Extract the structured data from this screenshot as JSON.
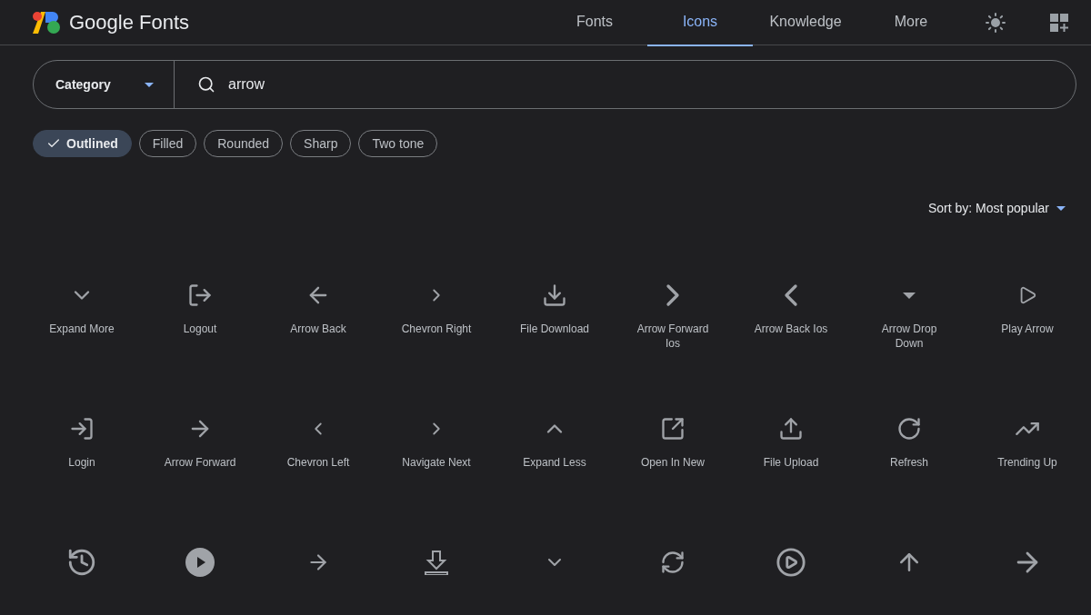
{
  "header": {
    "brand": "Google Fonts",
    "nav": [
      {
        "label": "Fonts",
        "selected": false
      },
      {
        "label": "Icons",
        "selected": true
      },
      {
        "label": "Knowledge",
        "selected": false
      },
      {
        "label": "More",
        "selected": false
      }
    ]
  },
  "search": {
    "category": "Category",
    "value": "arrow"
  },
  "styles": [
    {
      "label": "Outlined",
      "selected": true
    },
    {
      "label": "Filled",
      "selected": false
    },
    {
      "label": "Rounded",
      "selected": false
    },
    {
      "label": "Sharp",
      "selected": false
    },
    {
      "label": "Two tone",
      "selected": false
    }
  ],
  "sort": {
    "label": "Sort by: Most popular"
  },
  "icons": [
    {
      "label": "Expand More"
    },
    {
      "label": "Logout"
    },
    {
      "label": "Arrow Back"
    },
    {
      "label": "Chevron Right"
    },
    {
      "label": "File Download"
    },
    {
      "label": "Arrow Forward Ios"
    },
    {
      "label": "Arrow Back Ios"
    },
    {
      "label": "Arrow Drop Down"
    },
    {
      "label": "Play Arrow"
    },
    {
      "label": "Login"
    },
    {
      "label": "Arrow Forward"
    },
    {
      "label": "Chevron Left"
    },
    {
      "label": "Navigate Next"
    },
    {
      "label": "Expand Less"
    },
    {
      "label": "Open In New"
    },
    {
      "label": "File Upload"
    },
    {
      "label": "Refresh"
    },
    {
      "label": "Trending Up"
    }
  ]
}
